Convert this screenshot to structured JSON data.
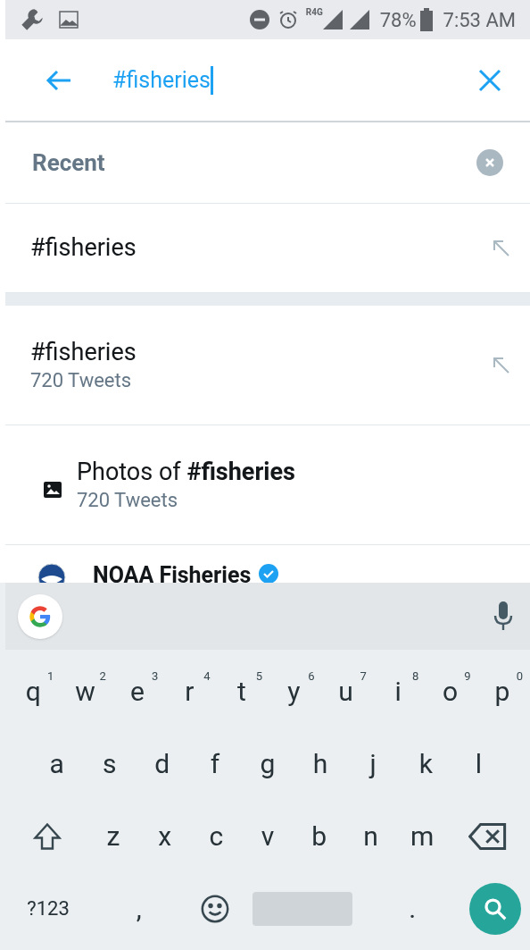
{
  "status_bar": {
    "network": "R4G",
    "battery": "78%",
    "time": "7:53 AM"
  },
  "search": {
    "value": "#fisheries"
  },
  "recent": {
    "title": "Recent",
    "items": [
      "#fisheries"
    ]
  },
  "suggestions": [
    {
      "kind": "hashtag",
      "title": "#fisheries",
      "subtitle": "720 Tweets"
    },
    {
      "kind": "photos",
      "title": "Photos of **#fisheries**",
      "subtitle": "720 Tweets"
    },
    {
      "kind": "account",
      "title": "NOAA Fisheries",
      "verified": true
    }
  ],
  "keyboard": {
    "rows": [
      [
        {
          "kind": "letter",
          "label": "q",
          "hint": "1"
        },
        {
          "kind": "letter",
          "label": "w",
          "hint": "2"
        },
        {
          "kind": "letter",
          "label": "e",
          "hint": "3"
        },
        {
          "kind": "letter",
          "label": "r",
          "hint": "4"
        },
        {
          "kind": "letter",
          "label": "t",
          "hint": "5"
        },
        {
          "kind": "letter",
          "label": "y",
          "hint": "6"
        },
        {
          "kind": "letter",
          "label": "u",
          "hint": "7"
        },
        {
          "kind": "letter",
          "label": "i",
          "hint": "8"
        },
        {
          "kind": "letter",
          "label": "o",
          "hint": "9"
        },
        {
          "kind": "letter",
          "label": "p",
          "hint": "0"
        }
      ],
      [
        {
          "kind": "letter",
          "label": "a"
        },
        {
          "kind": "letter",
          "label": "s"
        },
        {
          "kind": "letter",
          "label": "d"
        },
        {
          "kind": "letter",
          "label": "f"
        },
        {
          "kind": "letter",
          "label": "g"
        },
        {
          "kind": "letter",
          "label": "h"
        },
        {
          "kind": "letter",
          "label": "j"
        },
        {
          "kind": "letter",
          "label": "k"
        },
        {
          "kind": "letter",
          "label": "l"
        }
      ],
      [
        {
          "kind": "shift"
        },
        {
          "kind": "letter",
          "label": "z"
        },
        {
          "kind": "letter",
          "label": "x"
        },
        {
          "kind": "letter",
          "label": "c"
        },
        {
          "kind": "letter",
          "label": "v"
        },
        {
          "kind": "letter",
          "label": "b"
        },
        {
          "kind": "letter",
          "label": "n"
        },
        {
          "kind": "letter",
          "label": "m"
        },
        {
          "kind": "backspace"
        }
      ],
      [
        {
          "kind": "symbols",
          "label": "?123"
        },
        {
          "kind": "letter",
          "label": ","
        },
        {
          "kind": "emoji"
        },
        {
          "kind": "space"
        },
        {
          "kind": "letter",
          "label": "."
        },
        {
          "kind": "search"
        }
      ]
    ]
  }
}
